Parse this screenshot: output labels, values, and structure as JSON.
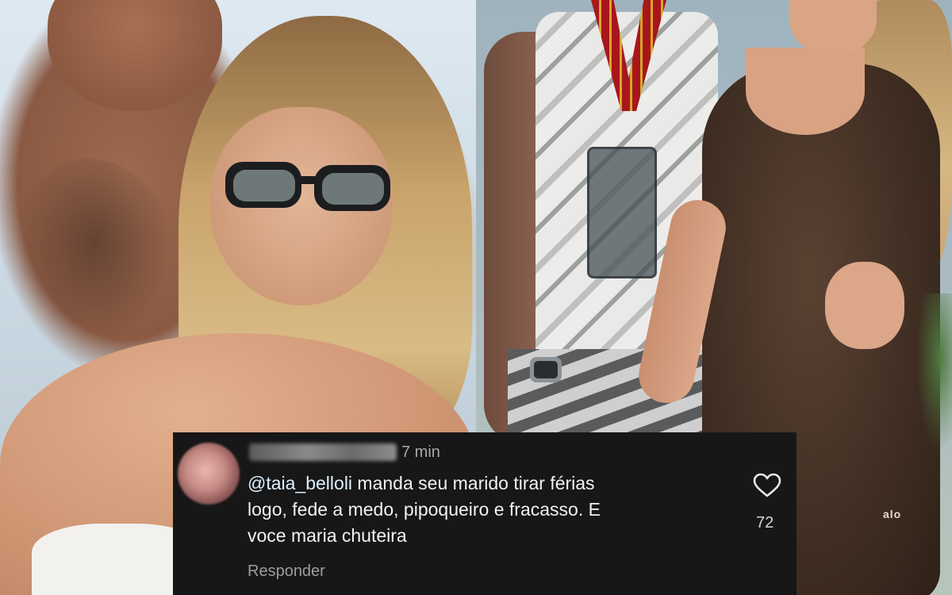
{
  "comment": {
    "timestamp": "7 min",
    "mention": "@taia_belloli",
    "text_line1": " manda seu marido tirar férias",
    "text_line2": "logo, fede a medo, pipoqueiro e fracasso. E",
    "text_line3": "voce maria chuteira",
    "like_icon": "heart-outline-icon",
    "like_count": "72",
    "reply_label": "Responder"
  },
  "photo_right": {
    "brand_logo_text": "alo"
  },
  "colors": {
    "comment_background": "#171717",
    "comment_text": "#f2f2f2",
    "muted_text": "#9e9e9e"
  }
}
